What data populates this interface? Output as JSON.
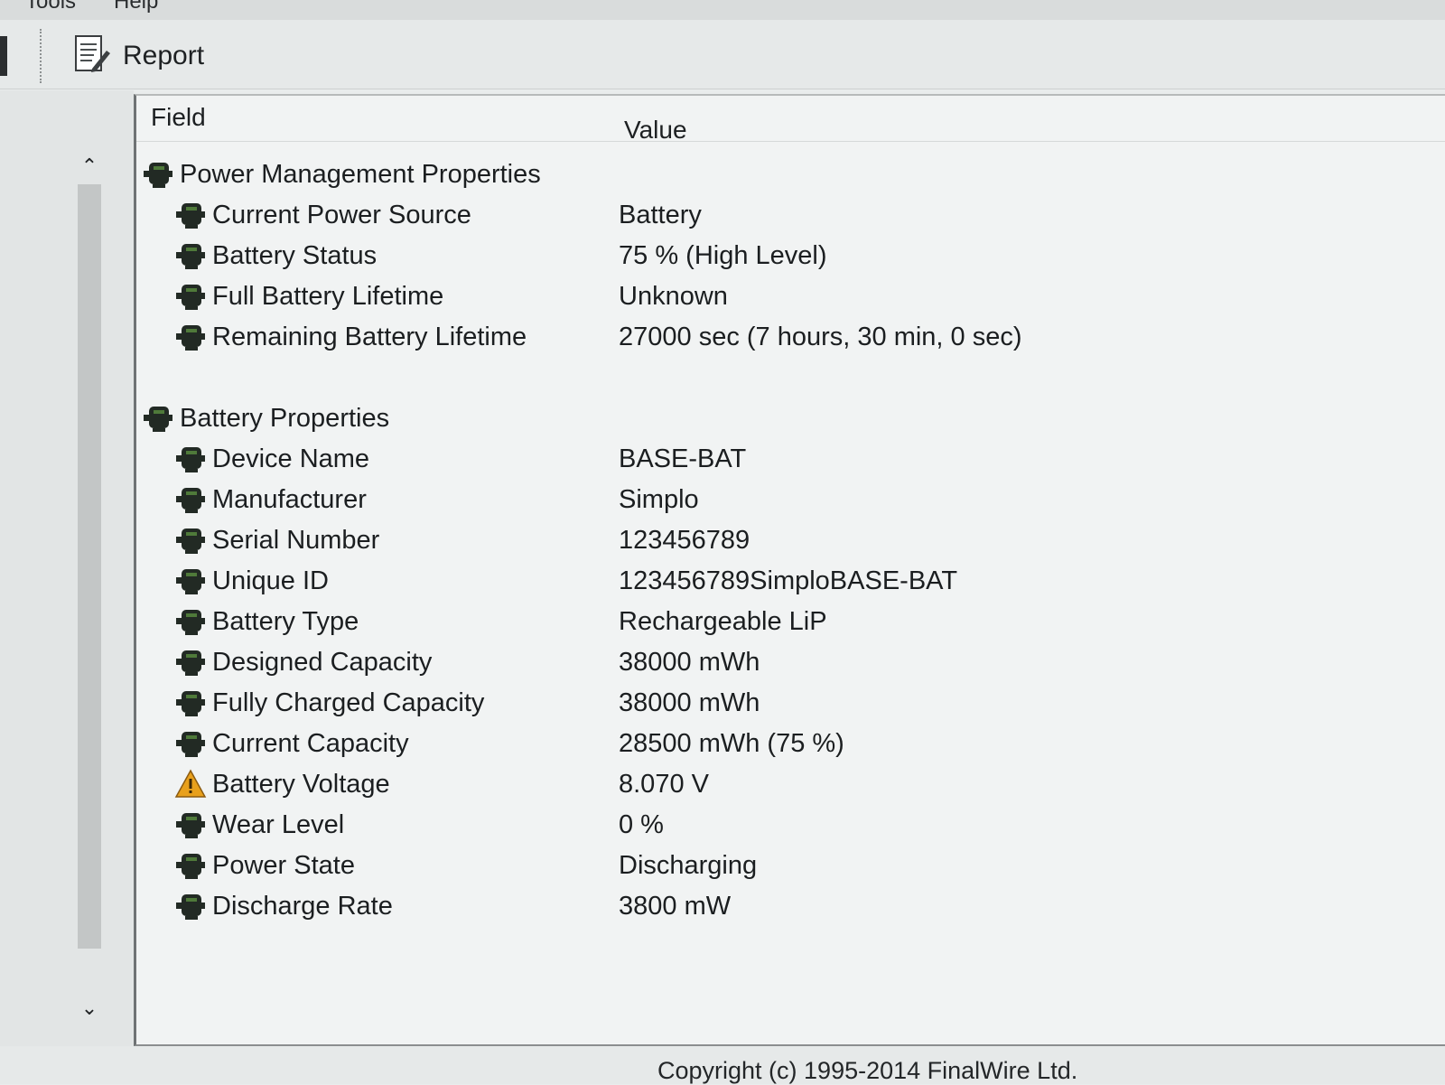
{
  "menubar": {
    "items": [
      "Tools",
      "Help"
    ]
  },
  "toolbar": {
    "report_label": "Report"
  },
  "list": {
    "columns": {
      "field": "Field",
      "value": "Value"
    },
    "sections": [
      {
        "title": "Power Management Properties",
        "icon": "battery-computer-icon",
        "rows": [
          {
            "field": "Current Power Source",
            "value": "Battery",
            "icon": "battery-computer-icon"
          },
          {
            "field": "Battery Status",
            "value": "75 % (High Level)",
            "icon": "battery-computer-icon"
          },
          {
            "field": "Full Battery Lifetime",
            "value": "Unknown",
            "icon": "battery-computer-icon"
          },
          {
            "field": "Remaining Battery Lifetime",
            "value": "27000 sec (7 hours, 30 min, 0 sec)",
            "icon": "battery-computer-icon"
          }
        ]
      },
      {
        "title": "Battery Properties",
        "icon": "battery-computer-icon",
        "rows": [
          {
            "field": "Device Name",
            "value": "BASE-BAT",
            "icon": "battery-computer-icon"
          },
          {
            "field": "Manufacturer",
            "value": "Simplo",
            "icon": "battery-computer-icon"
          },
          {
            "field": "Serial Number",
            "value": "123456789",
            "icon": "battery-computer-icon"
          },
          {
            "field": "Unique ID",
            "value": "123456789SimploBASE-BAT",
            "icon": "battery-computer-icon"
          },
          {
            "field": "Battery Type",
            "value": "Rechargeable LiP",
            "icon": "battery-computer-icon"
          },
          {
            "field": "Designed Capacity",
            "value": "38000 mWh",
            "icon": "battery-computer-icon"
          },
          {
            "field": "Fully Charged Capacity",
            "value": "38000 mWh",
            "icon": "battery-computer-icon"
          },
          {
            "field": "Current Capacity",
            "value": "28500 mWh  (75 %)",
            "icon": "battery-computer-icon"
          },
          {
            "field": "Battery Voltage",
            "value": "8.070 V",
            "icon": "warning-icon"
          },
          {
            "field": "Wear Level",
            "value": "0 %",
            "icon": "battery-computer-icon"
          },
          {
            "field": "Power State",
            "value": "Discharging",
            "icon": "battery-computer-icon"
          },
          {
            "field": "Discharge Rate",
            "value": "3800 mW",
            "icon": "battery-computer-icon"
          }
        ]
      }
    ]
  },
  "footer": {
    "copyright": "Copyright (c) 1995-2014 FinalWire Ltd."
  },
  "colors": {
    "panel_bg": "#f1f3f3",
    "icon_dark": "#222a24",
    "icon_green": "#4f7a3a",
    "warning_orange": "#e8a01c"
  }
}
